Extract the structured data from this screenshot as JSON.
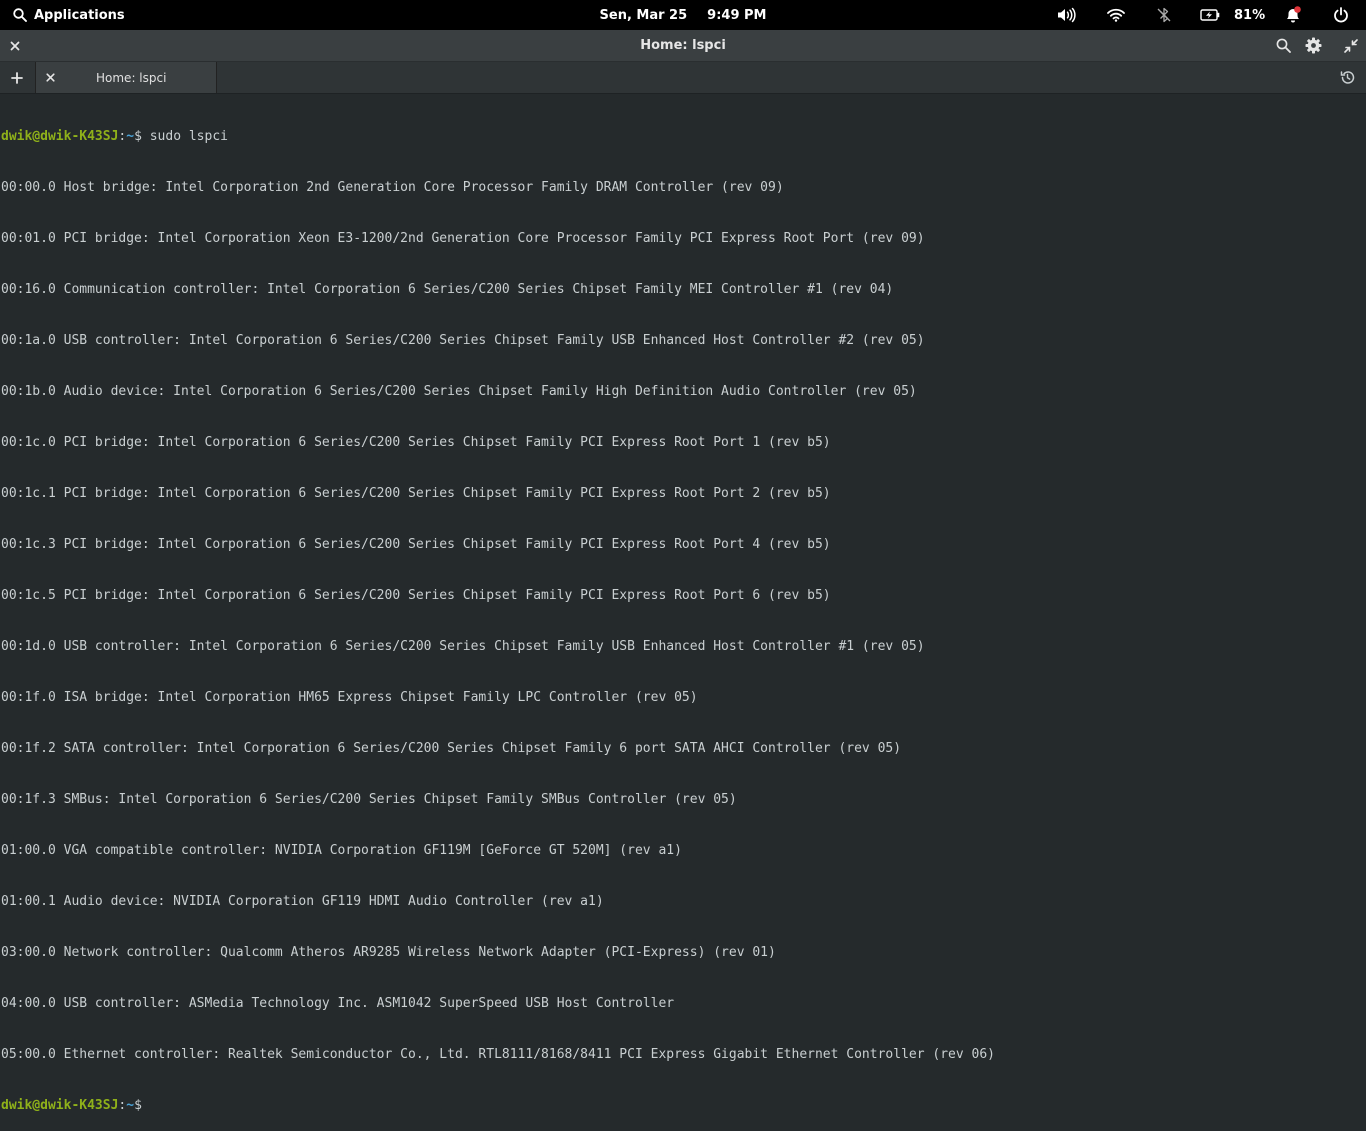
{
  "panel": {
    "applications_label": "Applications",
    "date": "Sen, Mar 25",
    "time": "9:49 PM",
    "battery_percent": "81%"
  },
  "window": {
    "title": "Home: lspci"
  },
  "tabs": [
    {
      "label": "Home: lspci"
    }
  ],
  "terminal": {
    "prompt": {
      "user_host": "dwik@dwik-K43SJ",
      "sep": ":",
      "path": "~",
      "symbol": "$"
    },
    "command": " sudo lspci",
    "output": [
      "00:00.0 Host bridge: Intel Corporation 2nd Generation Core Processor Family DRAM Controller (rev 09)",
      "00:01.0 PCI bridge: Intel Corporation Xeon E3-1200/2nd Generation Core Processor Family PCI Express Root Port (rev 09)",
      "00:16.0 Communication controller: Intel Corporation 6 Series/C200 Series Chipset Family MEI Controller #1 (rev 04)",
      "00:1a.0 USB controller: Intel Corporation 6 Series/C200 Series Chipset Family USB Enhanced Host Controller #2 (rev 05)",
      "00:1b.0 Audio device: Intel Corporation 6 Series/C200 Series Chipset Family High Definition Audio Controller (rev 05)",
      "00:1c.0 PCI bridge: Intel Corporation 6 Series/C200 Series Chipset Family PCI Express Root Port 1 (rev b5)",
      "00:1c.1 PCI bridge: Intel Corporation 6 Series/C200 Series Chipset Family PCI Express Root Port 2 (rev b5)",
      "00:1c.3 PCI bridge: Intel Corporation 6 Series/C200 Series Chipset Family PCI Express Root Port 4 (rev b5)",
      "00:1c.5 PCI bridge: Intel Corporation 6 Series/C200 Series Chipset Family PCI Express Root Port 6 (rev b5)",
      "00:1d.0 USB controller: Intel Corporation 6 Series/C200 Series Chipset Family USB Enhanced Host Controller #1 (rev 05)",
      "00:1f.0 ISA bridge: Intel Corporation HM65 Express Chipset Family LPC Controller (rev 05)",
      "00:1f.2 SATA controller: Intel Corporation 6 Series/C200 Series Chipset Family 6 port SATA AHCI Controller (rev 05)",
      "00:1f.3 SMBus: Intel Corporation 6 Series/C200 Series Chipset Family SMBus Controller (rev 05)",
      "01:00.0 VGA compatible controller: NVIDIA Corporation GF119M [GeForce GT 520M] (rev a1)",
      "01:00.1 Audio device: NVIDIA Corporation GF119 HDMI Audio Controller (rev a1)",
      "03:00.0 Network controller: Qualcomm Atheros AR9285 Wireless Network Adapter (PCI-Express) (rev 01)",
      "04:00.0 USB controller: ASMedia Technology Inc. ASM1042 SuperSpeed USB Host Controller",
      "05:00.0 Ethernet controller: Realtek Semiconductor Co., Ltd. RTL8111/8168/8411 PCI Express Gigabit Ethernet Controller (rev 06)"
    ]
  },
  "icons": {
    "search": "search-icon",
    "volume": "volume-icon",
    "wifi": "wifi-icon",
    "bluetooth": "bluetooth-disabled-icon",
    "battery": "battery-charging-icon",
    "notifications": "notification-bell-icon",
    "power": "power-icon",
    "close": "close-icon",
    "settings": "gear-icon",
    "unmaximize": "unmaximize-icon",
    "new_tab": "plus-icon",
    "history": "history-icon"
  },
  "colors": {
    "prompt_user": "#8fb11a",
    "prompt_path": "#4aa3d8",
    "terminal_bg": "#252a2c",
    "notification_dot": "#e0343a"
  }
}
